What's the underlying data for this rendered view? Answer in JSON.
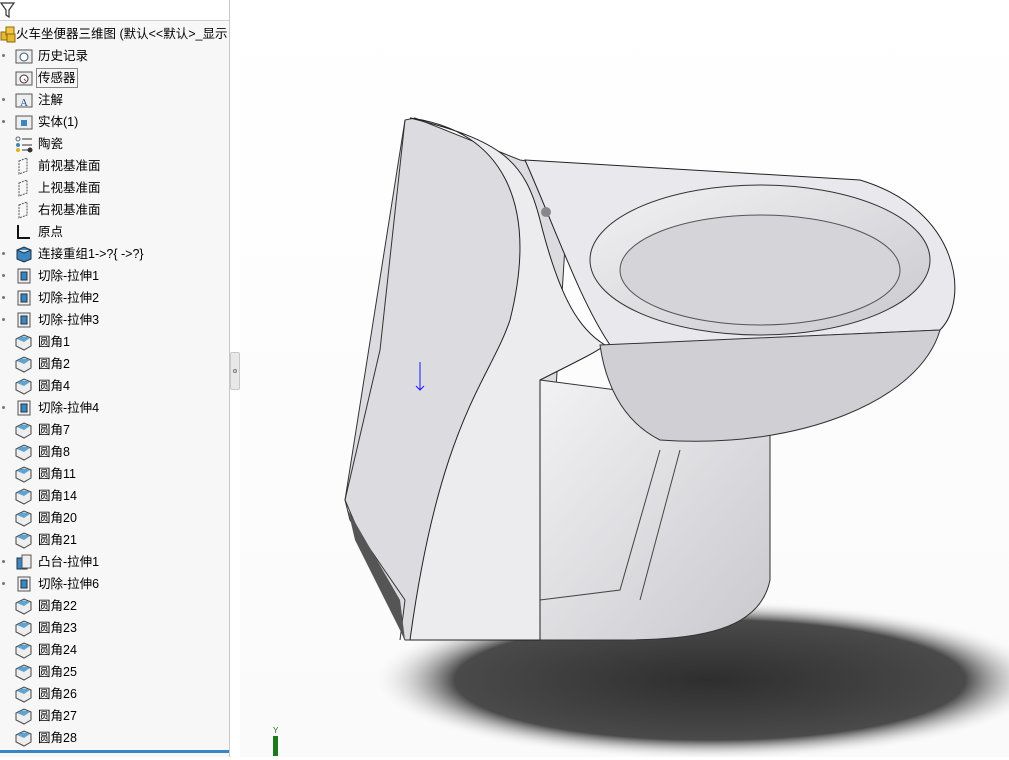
{
  "feature_tree": {
    "root": {
      "label": "火车坐便器三维图  (默认<<默认>_显示"
    },
    "items": [
      {
        "label": "历史记录",
        "icon": "history-folder-icon",
        "expandable": true
      },
      {
        "label": "传感器",
        "icon": "sensor-folder-icon",
        "expandable": false,
        "selected": true
      },
      {
        "label": "注解",
        "icon": "annotation-folder-icon",
        "expandable": true
      },
      {
        "label": "实体(1)",
        "icon": "solid-body-folder-icon",
        "expandable": true
      },
      {
        "label": "陶瓷",
        "icon": "material-icon",
        "expandable": false
      },
      {
        "label": "前视基准面",
        "icon": "plane-icon",
        "expandable": false
      },
      {
        "label": "上视基准面",
        "icon": "plane-icon",
        "expandable": false
      },
      {
        "label": "右视基准面",
        "icon": "plane-icon",
        "expandable": false
      },
      {
        "label": "原点",
        "icon": "origin-icon",
        "expandable": false
      },
      {
        "label": "连接重组1->?{ ->?}",
        "icon": "knit-icon",
        "expandable": true
      },
      {
        "label": "切除-拉伸1",
        "icon": "cut-extrude-icon",
        "expandable": true
      },
      {
        "label": "切除-拉伸2",
        "icon": "cut-extrude-icon",
        "expandable": true
      },
      {
        "label": "切除-拉伸3",
        "icon": "cut-extrude-icon",
        "expandable": true
      },
      {
        "label": "圆角1",
        "icon": "fillet-icon",
        "expandable": false
      },
      {
        "label": "圆角2",
        "icon": "fillet-icon",
        "expandable": false
      },
      {
        "label": "圆角4",
        "icon": "fillet-icon",
        "expandable": false
      },
      {
        "label": "切除-拉伸4",
        "icon": "cut-extrude-icon",
        "expandable": true
      },
      {
        "label": "圆角7",
        "icon": "fillet-icon",
        "expandable": false
      },
      {
        "label": "圆角8",
        "icon": "fillet-icon",
        "expandable": false
      },
      {
        "label": "圆角11",
        "icon": "fillet-icon",
        "expandable": false
      },
      {
        "label": "圆角14",
        "icon": "fillet-icon",
        "expandable": false
      },
      {
        "label": "圆角20",
        "icon": "fillet-icon",
        "expandable": false
      },
      {
        "label": "圆角21",
        "icon": "fillet-icon",
        "expandable": false
      },
      {
        "label": "凸台-拉伸1",
        "icon": "boss-extrude-icon",
        "expandable": true
      },
      {
        "label": "切除-拉伸6",
        "icon": "cut-extrude-icon",
        "expandable": true
      },
      {
        "label": "圆角22",
        "icon": "fillet-icon",
        "expandable": false
      },
      {
        "label": "圆角23",
        "icon": "fillet-icon",
        "expandable": false
      },
      {
        "label": "圆角24",
        "icon": "fillet-icon",
        "expandable": false
      },
      {
        "label": "圆角25",
        "icon": "fillet-icon",
        "expandable": false
      },
      {
        "label": "圆角26",
        "icon": "fillet-icon",
        "expandable": false
      },
      {
        "label": "圆角27",
        "icon": "fillet-icon",
        "expandable": false
      },
      {
        "label": "圆角28",
        "icon": "fillet-icon",
        "expandable": false
      }
    ]
  },
  "viewport": {
    "triad_axis_label": "Y"
  },
  "colors": {
    "accent": "#3a86c0",
    "model": "#e6e6ea",
    "shadow": "#3a3a3a"
  }
}
